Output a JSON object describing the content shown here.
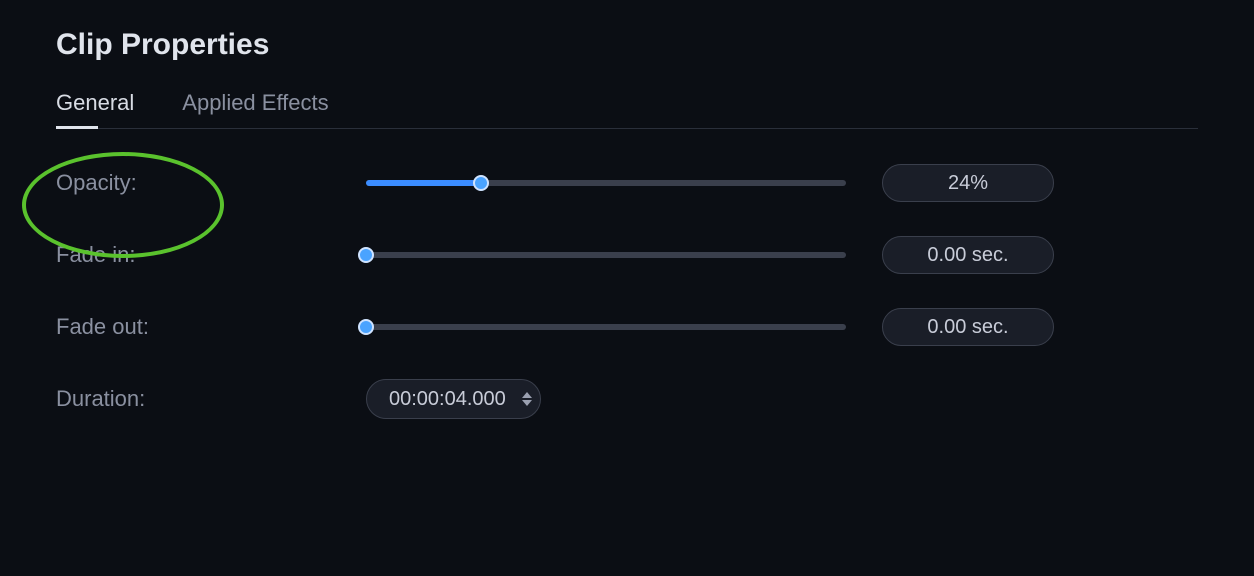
{
  "panel": {
    "title": "Clip Properties"
  },
  "tabs": {
    "general": "General",
    "applied_effects": "Applied Effects"
  },
  "rows": {
    "opacity": {
      "label": "Opacity:",
      "value_display": "24%",
      "percent": 24
    },
    "fade_in": {
      "label": "Fade in:",
      "value_display": "0.00 sec.",
      "percent": 0
    },
    "fade_out": {
      "label": "Fade out:",
      "value_display": "0.00 sec.",
      "percent": 0
    },
    "duration": {
      "label": "Duration:",
      "value_display": "00:00:04.000"
    }
  }
}
